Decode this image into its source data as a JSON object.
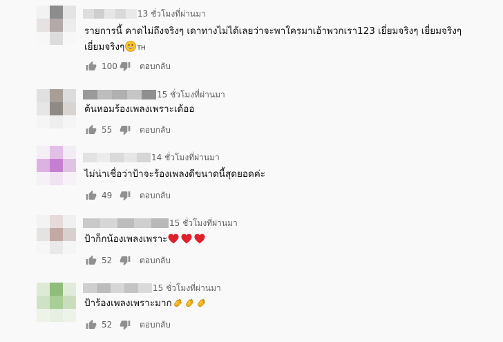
{
  "comments": [
    {
      "time": "13 ชั่วโมงที่ผ่านมา",
      "line1": "รายการนี้ คาดไม่ถึงจริงๆ เดาทางไม่ได้เลยว่าจะพาใครมาเอ้าพวกเรา123 เยี่ยมจริงๆ เยี่ยมจริงๆ",
      "line2": "เยี่ยมจริงๆ",
      "tag": "TH",
      "likes": "100",
      "reply": "ตอบกลับ",
      "avatar_colors": [
        "#f2f2f2",
        "#8c8c8c",
        "#e4e4e4",
        "#e6e2e2",
        "#b4a9a9",
        "#ececec",
        "#f7f7f7",
        "#dcdcdc",
        "#f7f7f7"
      ],
      "name_colors": [
        "#dedede",
        "#cfcfcf",
        "#e6e6e6",
        "#d9d9d9",
        "#e9e9e9"
      ]
    },
    {
      "time": "15 ชั่วโมงที่ผ่านมา",
      "line1": "ต้นหอมร้องเพลงเพราะเด้ออ",
      "likes": "55",
      "reply": "ตอบกลับ",
      "avatar_colors": [
        "#e0e0e0",
        "#a79f97",
        "#dcdcdc",
        "#e6e6e6",
        "#908a86",
        "#d8d4d2",
        "#f5f5f5",
        "#eeeeee",
        "#f5f5f5"
      ],
      "name_colors": [
        "#9a9a9a",
        "#bdbdbd",
        "#b0b0b0",
        "#c6c6c6",
        "#8f8f8f"
      ]
    },
    {
      "time": "14 ชั่วโมงที่ผ่านมา",
      "line1": "ไม่น่าเชื่อว่าป้าจะร้องเพลงดีขนาดนี้สุดยอดค่ะ",
      "likes": "49",
      "reply": "ตอบกลับ",
      "avatar_colors": [
        "#f4eef5",
        "#e2bfe7",
        "#f2edf4",
        "#dcb3e0",
        "#c47fd0",
        "#e0c2e5",
        "#f6f1f7",
        "#efe3f1",
        "#f7f2f7"
      ],
      "name_colors": [
        "#e2e2e2",
        "#ececec",
        "#dadada",
        "#e6e6e6",
        "#d6d6d6"
      ]
    },
    {
      "time": "15 ชั่วโมงที่ผ่านมา",
      "line1": "ป้าก็กน้องเพลงเพราะ",
      "likes": "52",
      "reply": "ตอบกลับ",
      "avatar_colors": [
        "#f3f3f3",
        "#e6dada",
        "#f0f0f0",
        "#e5e2e2",
        "#c2a9a4",
        "#d8d0cf",
        "#f6f6f6",
        "#e9e9e9",
        "#f5f5f5"
      ],
      "name_colors": [
        "#c9c9c9",
        "#d6d6d6",
        "#bdbdbd",
        "#cfcfcf",
        "#b8b8b8"
      ]
    },
    {
      "time": "15 ชั่วโมงที่ผ่านมา",
      "line1": "ป้าร้องเพลงเพราะมาก",
      "likes": "52",
      "reply": "ตอบกลับ",
      "avatar_colors": [
        "#dfe9d8",
        "#8fbd7a",
        "#e1ebdb",
        "#cfe2c6",
        "#a9cf97",
        "#c9ddbd",
        "#eef3ea",
        "#e6efe1",
        "#eef3ea"
      ],
      "name_colors": [
        "#cfcfcf",
        "#bcbcbc",
        "#d6d6d6",
        "#c4c4c4",
        "#dadada"
      ]
    }
  ],
  "icons": {
    "like": "thumbs-up-icon",
    "dislike": "thumbs-down-icon",
    "heart": "red-heart-emoji",
    "clap": "clapping-hands-emoji",
    "smile": "grinning-face-emoji"
  },
  "colors": {
    "background": "#f9f9f9",
    "text": "#0f0f0f",
    "secondary": "#606060",
    "heart": "#e0202a",
    "clap": "#f4b41a"
  }
}
